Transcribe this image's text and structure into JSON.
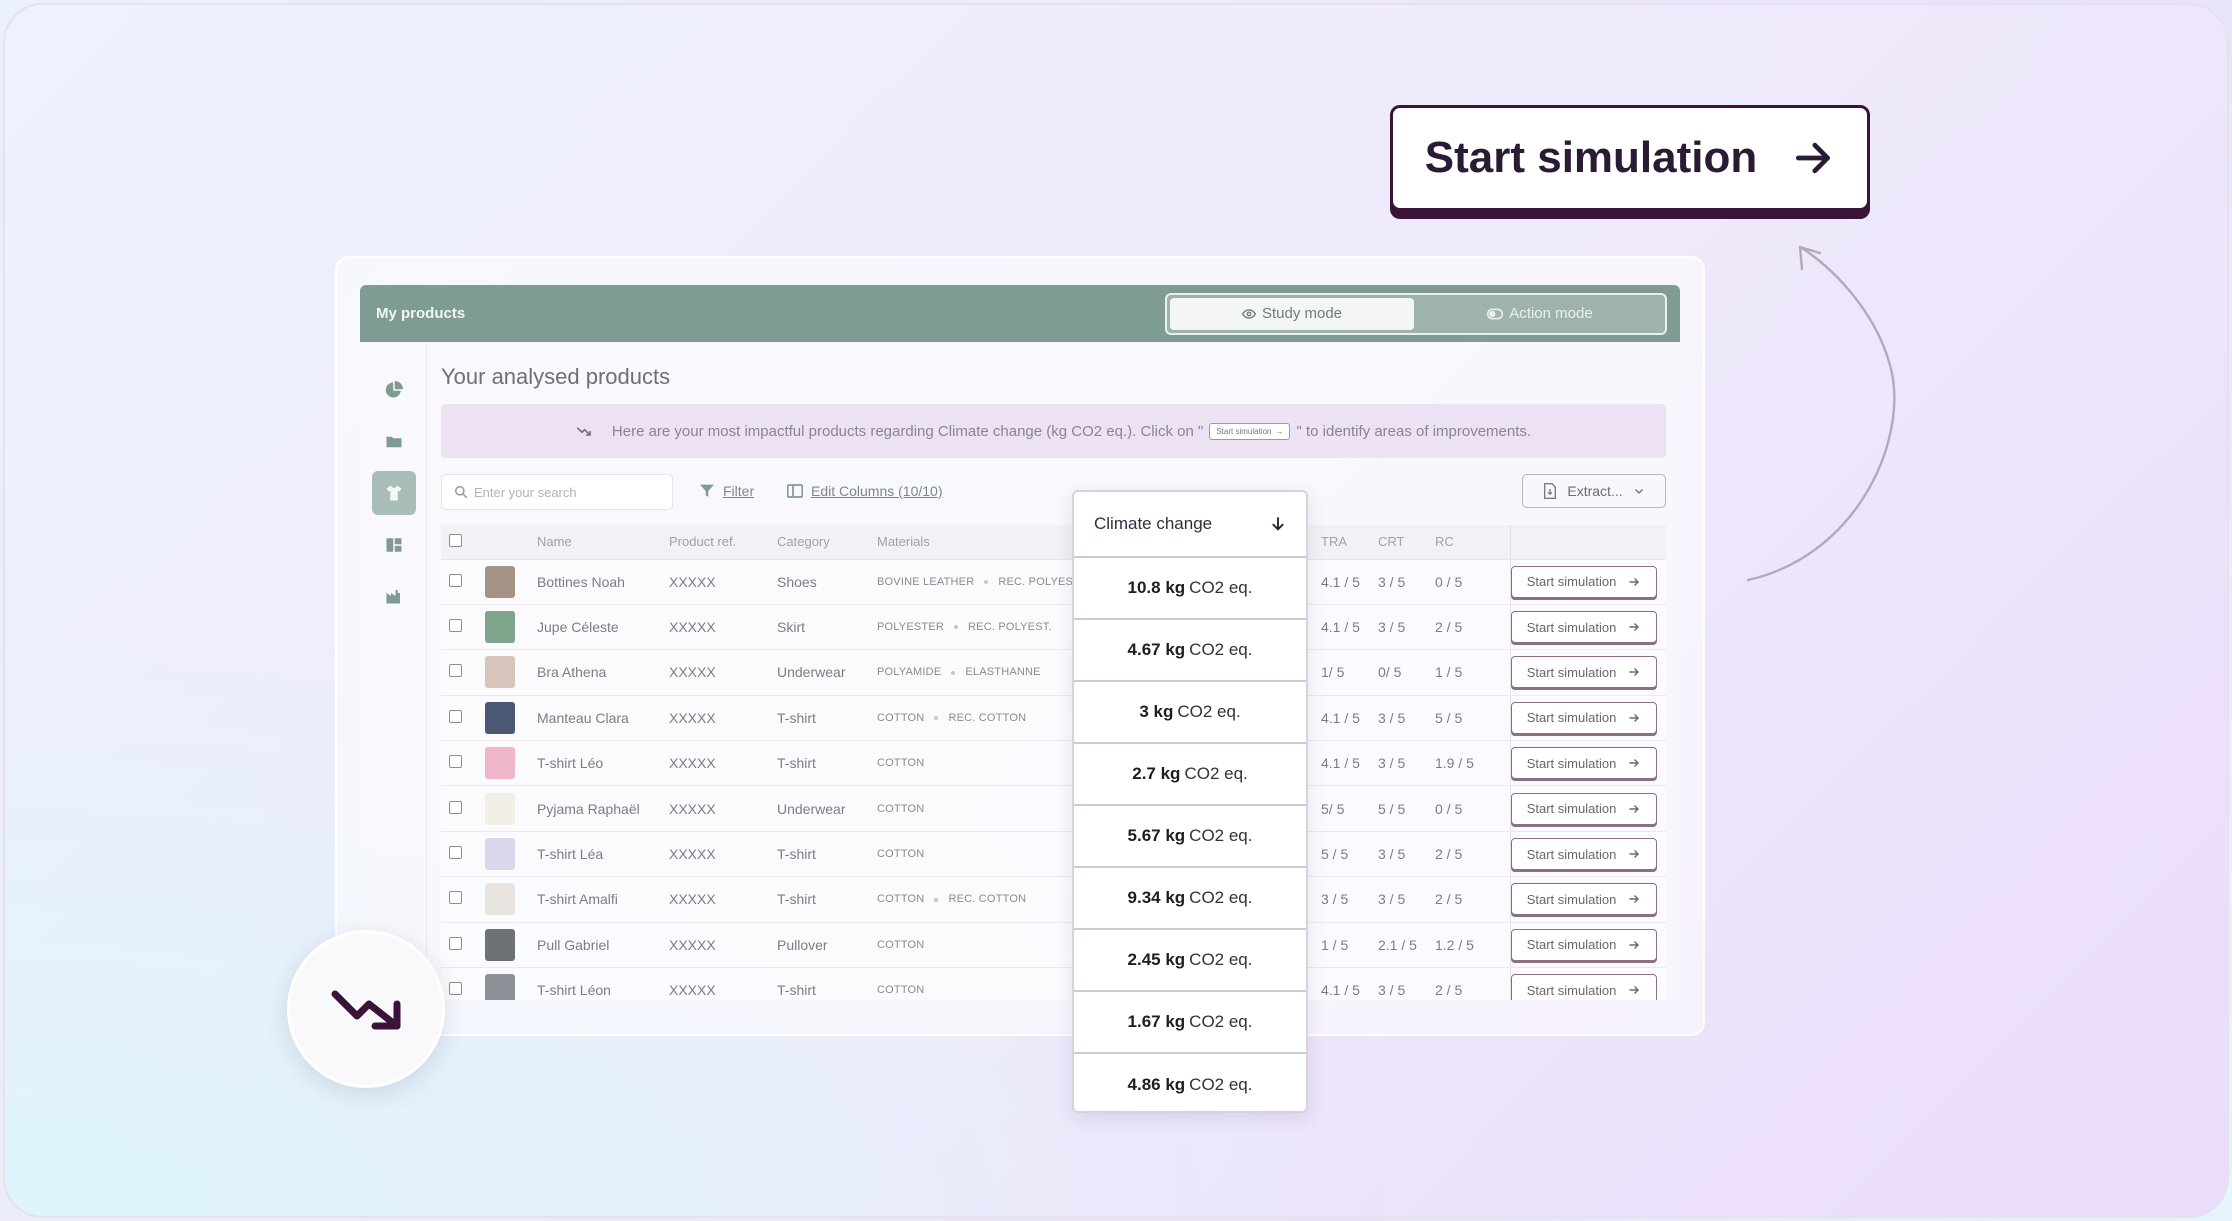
{
  "cta": {
    "label": "Start simulation"
  },
  "header": {
    "title": "My products",
    "modes": [
      {
        "label": "Study mode",
        "active": true,
        "icon": "eye-icon"
      },
      {
        "label": "Action mode",
        "active": false,
        "icon": "toggle-icon"
      }
    ]
  },
  "sidebar": {
    "items": [
      {
        "icon": "pie-chart-icon",
        "active": false
      },
      {
        "icon": "folder-icon",
        "active": false
      },
      {
        "icon": "tshirt-icon",
        "active": true
      },
      {
        "icon": "tag-icon",
        "active": false
      },
      {
        "icon": "factory-icon",
        "active": false
      }
    ],
    "bottom_icon": "user-settings-icon"
  },
  "page": {
    "title": "Your analysed products",
    "notice_before": "Here are your most impactful products regarding  Climate change (kg CO2 eq.). Click on \"",
    "notice_button": "Start simulation",
    "notice_after": "\" to identify areas of improvements."
  },
  "toolbar": {
    "search_placeholder": "Enter your search",
    "filter_label": "Filter",
    "edit_columns_label": "Edit Columns (10/10)",
    "extract_label": "Extract..."
  },
  "table": {
    "columns": [
      "Name",
      "Product ref.",
      "Category",
      "Materials",
      "TRA",
      "CRT",
      "RC"
    ],
    "action_label": "Start simulation",
    "rows": [
      {
        "name": "Bottines Noah",
        "ref": "XXXXX",
        "category": "Shoes",
        "materials": [
          "BOVINE LEATHER",
          "REC. POLYEST."
        ],
        "tra": "4.1 / 5",
        "crt": "3 / 5",
        "rc": "0 / 5",
        "thumb": "#a59386"
      },
      {
        "name": "Jupe Céleste",
        "ref": "XXXXX",
        "category": "Skirt",
        "materials": [
          "POLYESTER",
          "REC. POLYEST."
        ],
        "tra": "4.1 / 5",
        "crt": "3 / 5",
        "rc": "2 / 5",
        "thumb": "#7ea58b"
      },
      {
        "name": "Bra Athena",
        "ref": "XXXXX",
        "category": "Underwear",
        "materials": [
          "POLYAMIDE",
          "ELASTHANNE"
        ],
        "tra": "1/ 5",
        "crt": "0/ 5",
        "rc": "1 / 5",
        "thumb": "#d8c6bd"
      },
      {
        "name": "Manteau Clara",
        "ref": "XXXXX",
        "category": "T-shirt",
        "materials": [
          "COTTON",
          "REC. COTTON"
        ],
        "tra": "4.1 / 5",
        "crt": "3 / 5",
        "rc": "5 / 5",
        "thumb": "#4a5775"
      },
      {
        "name": "T-shirt Léo",
        "ref": "XXXXX",
        "category": "T-shirt",
        "materials": [
          "COTTON"
        ],
        "tra": "4.1 / 5",
        "crt": "3 / 5",
        "rc": "1.9 / 5",
        "thumb": "#efb6cc"
      },
      {
        "name": "Pyjama Raphaël",
        "ref": "XXXXX",
        "category": "Underwear",
        "materials": [
          "COTTON"
        ],
        "tra": "5/ 5",
        "crt": "5 / 5",
        "rc": "0 / 5",
        "thumb": "#f1efe6"
      },
      {
        "name": "T-shirt Léa",
        "ref": "XXXXX",
        "category": "T-shirt",
        "materials": [
          "COTTON"
        ],
        "tra": "5 / 5",
        "crt": "3 / 5",
        "rc": "2 / 5",
        "thumb": "#dcd6ea"
      },
      {
        "name": "T-shirt Amalfi",
        "ref": "XXXXX",
        "category": "T-shirt",
        "materials": [
          "COTTON",
          "REC. COTTON"
        ],
        "tra": "3 / 5",
        "crt": "3 / 5",
        "rc": "2 / 5",
        "thumb": "#e9e6e2"
      },
      {
        "name": "Pull Gabriel",
        "ref": "XXXXX",
        "category": "Pullover",
        "materials": [
          "COTTON"
        ],
        "tra": "1 / 5",
        "crt": "2.1 / 5",
        "rc": "1.2 / 5",
        "thumb": "#6e7276"
      },
      {
        "name": "T-shirt Léon",
        "ref": "XXXXX",
        "category": "T-shirt",
        "materials": [
          "COTTON"
        ],
        "tra": "4.1 / 5",
        "crt": "3 / 5",
        "rc": "2 / 5",
        "thumb": "#8d9096"
      }
    ]
  },
  "climate": {
    "header": "Climate change",
    "unit": "CO2 eq.",
    "values": [
      "10.8 kg",
      "4.67 kg",
      "3 kg",
      "2.7 kg",
      "5.67 kg",
      "9.34 kg",
      "2.45 kg",
      "1.67 kg",
      "4.86 kg"
    ]
  },
  "badge": {
    "icon": "trend-down-icon"
  },
  "colors": {
    "brand_dark": "#3a1438",
    "header_green": "#7e9b94",
    "notice_bg": "#ece2f3"
  }
}
